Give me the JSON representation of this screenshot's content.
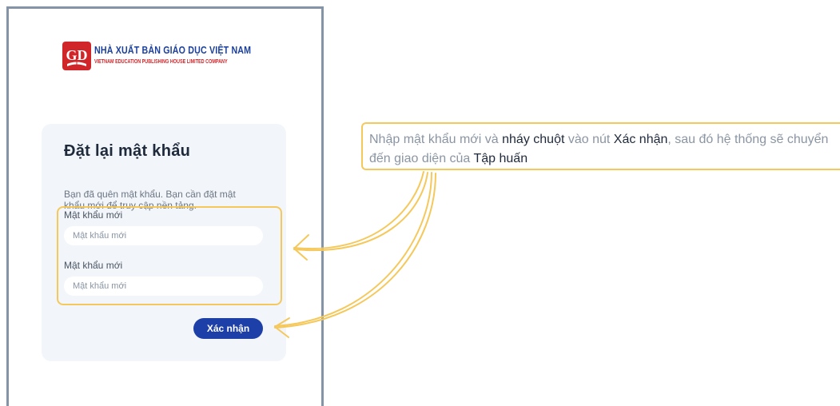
{
  "brand": {
    "title": "NHÀ XUẤT BẢN GIÁO DỤC VIỆT NAM",
    "subtitle": "VIETNAM EDUCATION PUBLISHING HOUSE LIMITED COMPANY",
    "logo_letters": "GD"
  },
  "form": {
    "title": "Đặt lại mật khẩu",
    "description": "Bạn đã quên mật khẩu. Bạn cần đặt mật khẩu mới để truy cập nền tảng.",
    "fields": [
      {
        "label": "Mật khẩu mới",
        "placeholder": "Mật khẩu mới",
        "value": ""
      },
      {
        "label": "Mật khẩu mới",
        "placeholder": "Mật khẩu mới",
        "value": ""
      }
    ],
    "submit_label": "Xác nhận"
  },
  "callout": {
    "parts": [
      "Nhập mật khẩu mới và ",
      "nháy chuột",
      " vào nút ",
      "Xác nhận",
      ", sau đó hệ thống sẽ chuyển đến giao diện của ",
      "Tập huấn"
    ]
  },
  "colors": {
    "highlight": "#f5c85b",
    "primary_button": "#1d3fa8",
    "brand_red": "#d0262a",
    "brand_blue": "#1b3f9c"
  }
}
